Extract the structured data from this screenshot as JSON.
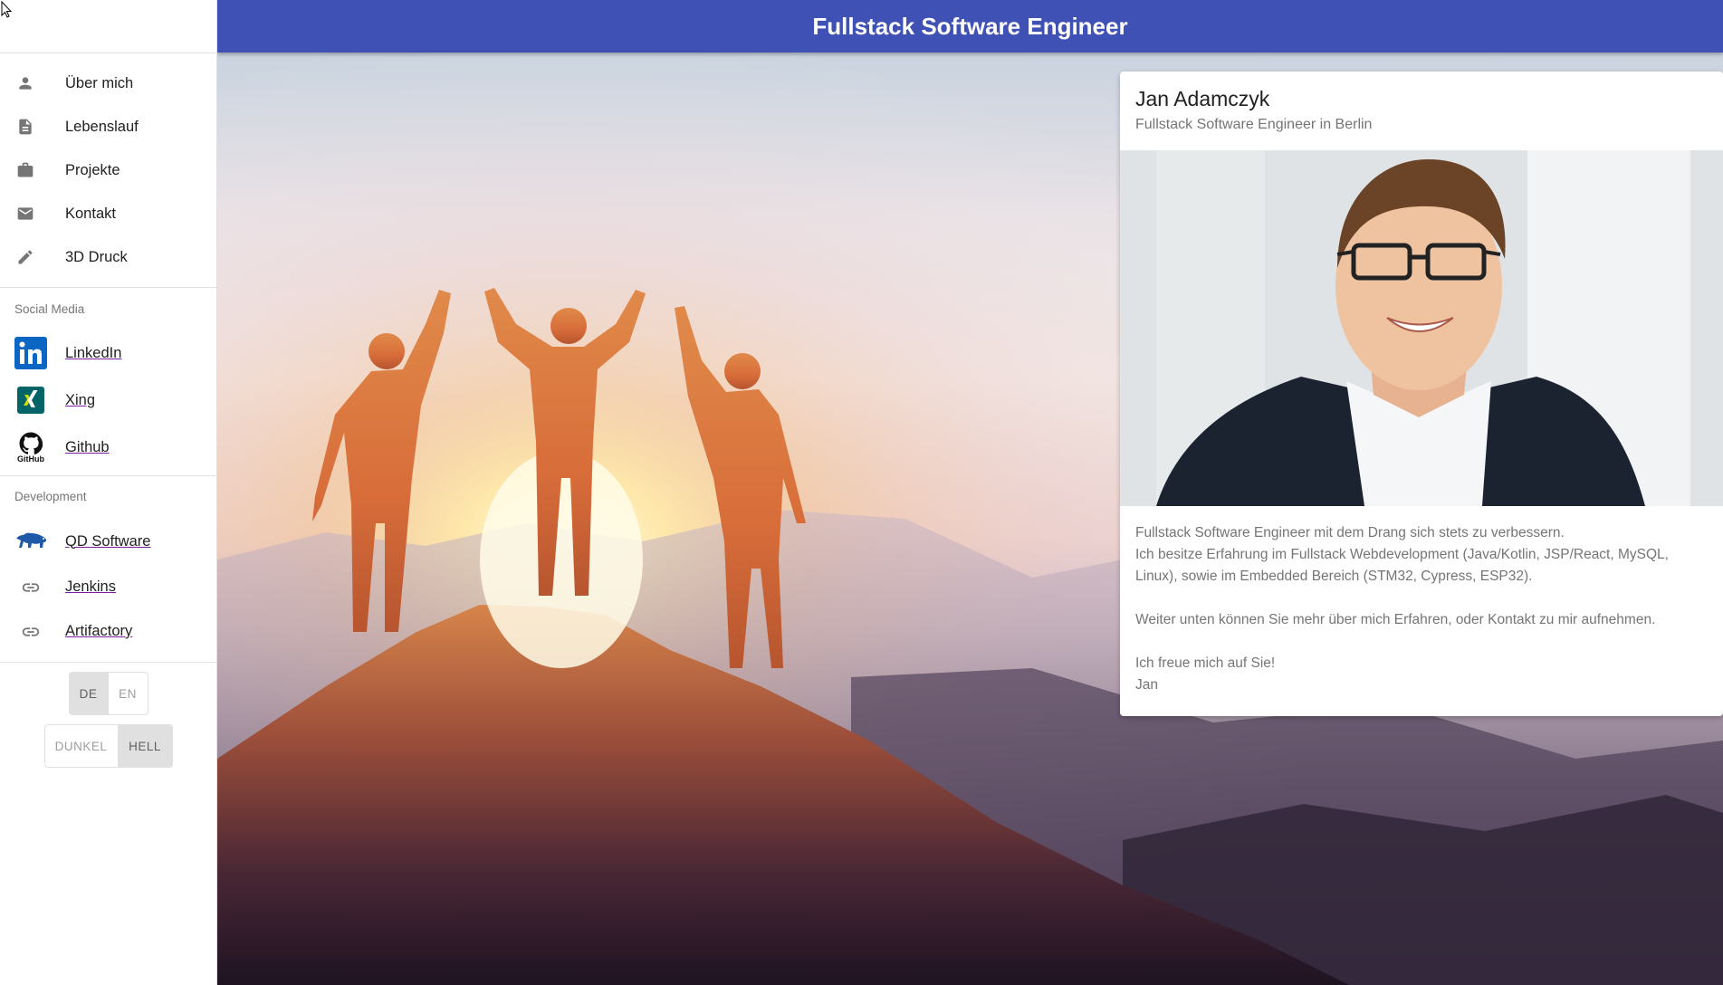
{
  "header": {
    "title": "Fullstack Software Engineer"
  },
  "nav": {
    "items": [
      {
        "icon": "person-icon",
        "label": "Über mich"
      },
      {
        "icon": "document-icon",
        "label": "Lebenslauf"
      },
      {
        "icon": "briefcase-icon",
        "label": "Projekte"
      },
      {
        "icon": "mail-icon",
        "label": "Kontakt"
      },
      {
        "icon": "pencil-icon",
        "label": "3D Druck"
      }
    ]
  },
  "social": {
    "heading": "Social Media",
    "links": [
      {
        "icon": "linkedin-icon",
        "label": "LinkedIn"
      },
      {
        "icon": "xing-icon",
        "label": "Xing"
      },
      {
        "icon": "github-icon",
        "label": "Github",
        "icon_text": "GitHub"
      }
    ]
  },
  "development": {
    "heading": "Development",
    "links": [
      {
        "icon": "bear-icon",
        "label": "QD Software"
      },
      {
        "icon": "link-icon",
        "label": "Jenkins"
      },
      {
        "icon": "link-icon",
        "label": "Artifactory"
      }
    ]
  },
  "language_toggle": {
    "options": [
      "DE",
      "EN"
    ],
    "selected": "DE"
  },
  "theme_toggle": {
    "options": [
      "DUNKEL",
      "HELL"
    ],
    "selected": "HELL"
  },
  "card": {
    "name": "Jan Adamczyk",
    "subtitle": "Fullstack Software Engineer in Berlin",
    "lines": {
      "l1": "Fullstack Software Engineer mit dem Drang sich stets zu verbessern.",
      "l2": "Ich besitze Erfahrung im Fullstack Webdevelopment (Java/Kotlin, JSP/React, MySQL, Linux), sowie im Embedded Bereich (STM32, Cypress, ESP32).",
      "l3": "Weiter unten können Sie mehr über mich Erfahren, oder Kontakt zu mir aufnehmen.",
      "l4": "Ich freue mich auf Sie!",
      "l5": "Jan"
    }
  },
  "colors": {
    "header": "#3f51b5",
    "accent_underline": "#7b1fa2",
    "linkedin": "#0a66c2",
    "xing": "#026466",
    "xing_accent": "#cfdc00",
    "bear": "#1e5aa8"
  }
}
